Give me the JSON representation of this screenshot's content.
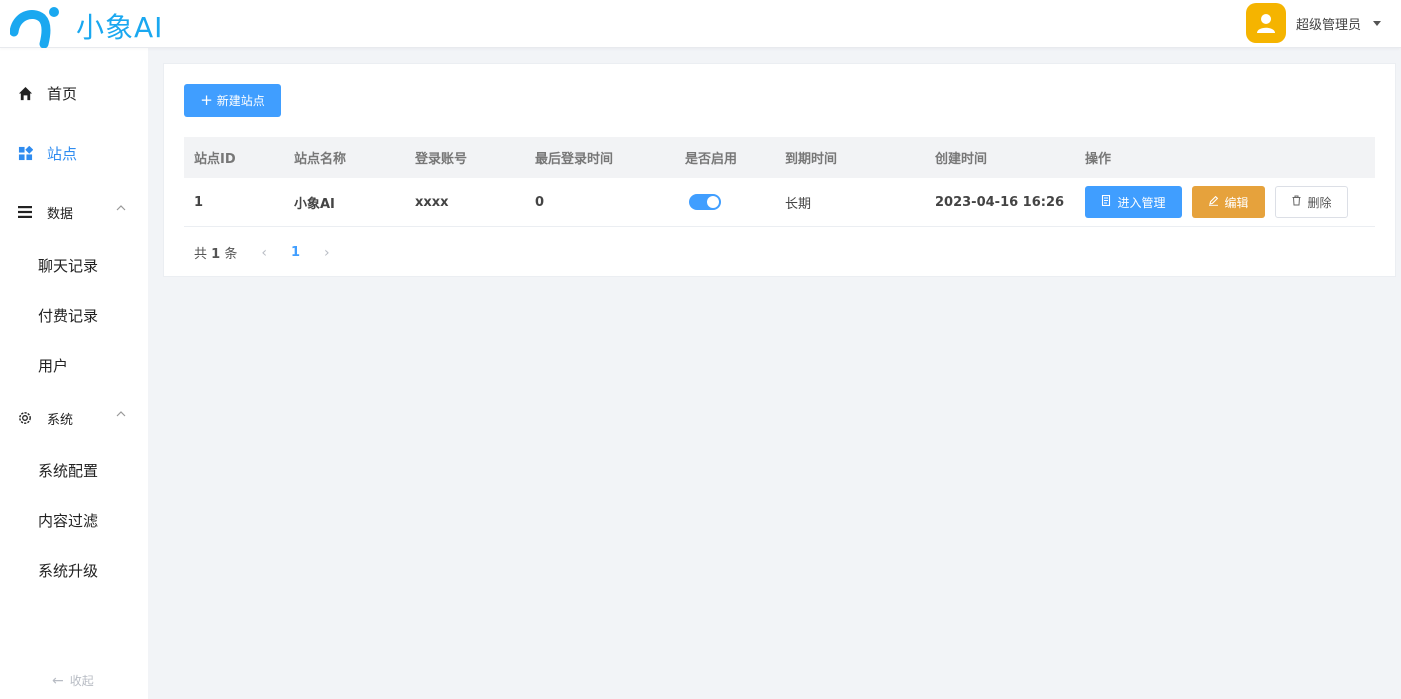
{
  "header": {
    "logo_text": "小象AI",
    "user_name": "超级管理员"
  },
  "sidebar": {
    "items": [
      {
        "label": "首页",
        "icon": "home-icon"
      },
      {
        "label": "站点",
        "icon": "site-grid-icon",
        "active": true
      },
      {
        "label": "数据",
        "icon": "menu-list-icon",
        "children": [
          "聊天记录",
          "付费记录",
          "用户"
        ]
      },
      {
        "label": "系统",
        "icon": "gear-icon",
        "children": [
          "系统配置",
          "内容过滤",
          "系统升级"
        ]
      }
    ],
    "collapse_label": "收起"
  },
  "toolbar": {
    "new_site_label": "新建站点"
  },
  "table": {
    "columns": [
      "站点ID",
      "站点名称",
      "登录账号",
      "最后登录时间",
      "是否启用",
      "到期时间",
      "创建时间",
      "操作"
    ],
    "rows": [
      {
        "id": "1",
        "name": "小象AI",
        "account": "xxxx",
        "last_login": "0",
        "enabled": true,
        "expire": "长期",
        "created": "2023-04-16 16:26"
      }
    ],
    "actions": {
      "manage": "进入管理",
      "edit": "编辑",
      "delete": "删除"
    }
  },
  "pagination": {
    "total_prefix": "共",
    "total_count": "1",
    "total_suffix": "条",
    "current_page": "1"
  },
  "colors": {
    "primary": "#409eff",
    "warning": "#e6a23c",
    "logo": "#1aa8f0",
    "avatar": "#f5b400"
  }
}
